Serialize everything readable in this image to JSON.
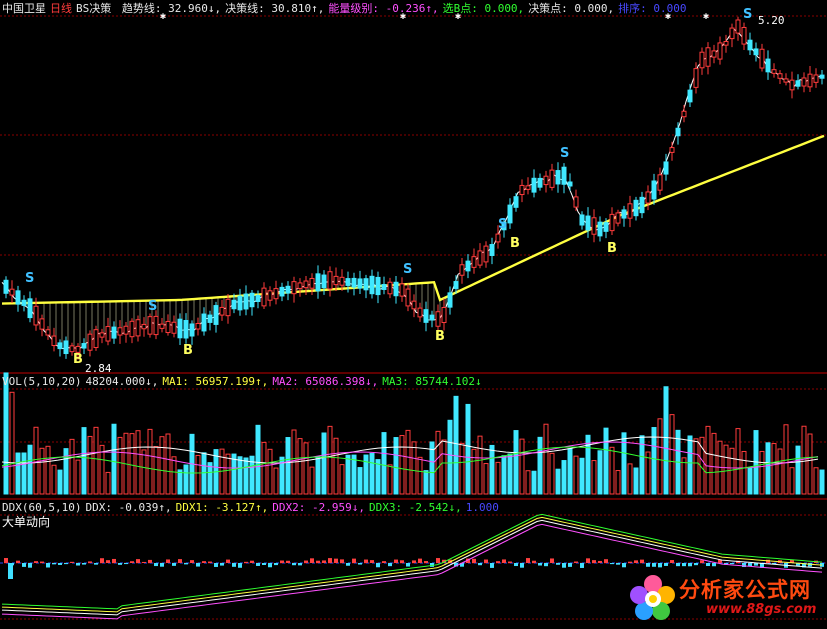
{
  "header": {
    "stock_name": "中国卫星",
    "period": "日线",
    "indicator": "BS决策",
    "trend_label": "趋势线: 32.960↓,",
    "decision_label": "决策线: 30.810↑,",
    "energy_label": "能量级别: -0.236↑,",
    "select_label": "选B点: 0.000,",
    "decide_label": "决策点: 0.000,",
    "rank_label": "排序: 0.000"
  },
  "price_labels": {
    "high": "5.20",
    "low": "2.84"
  },
  "signals": {
    "sell": "S",
    "buy": "B"
  },
  "vol_header": {
    "name": "VOL(5,10,20)",
    "vol": "48204.000↓,",
    "ma1": "MA1: 56957.199↑,",
    "ma2": "MA2: 65086.398↓,",
    "ma3": "MA3: 85744.102↓"
  },
  "ddx_header": {
    "name": "DDX(60,5,10)",
    "ddx": "DDX: -0.039↑,",
    "ddx1": "DDX1: -3.127↑,",
    "ddx2": "DDX2: -2.959↓,",
    "ddx3": "DDX3: -2.542↓,",
    "val": "1.000"
  },
  "ddx_sub": "大单动向",
  "watermark": {
    "name": "分析家公式网",
    "url": "www.88gs.com"
  },
  "colors": {
    "up": "#ff3c3c",
    "down": "#40e8ff",
    "trend": "#ffff40",
    "grid": "#8a0000"
  }
}
